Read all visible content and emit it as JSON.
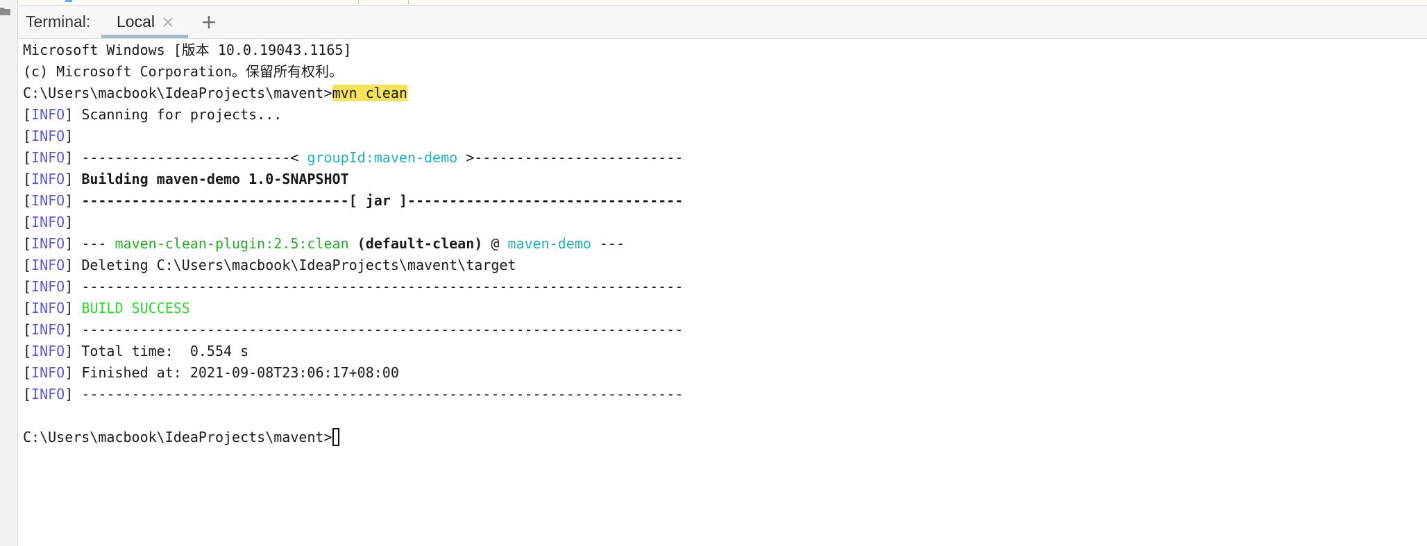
{
  "header": {
    "title": "Terminal:",
    "tabs": [
      {
        "label": "Local"
      }
    ]
  },
  "colors": {
    "info_level": "#5a5ad6",
    "cyan": "#1ab5b8",
    "green": "#22b022",
    "success": "#2bd92b",
    "command_highlight": "#f7e35a"
  },
  "icons": [
    "folder-icon",
    "close-icon",
    "plus-icon"
  ],
  "terminal": {
    "lines": {
      "l1": "Microsoft Windows [版本 10.0.19043.1165]",
      "l2": "(c) Microsoft Corporation。保留所有权利。",
      "l3": {
        "prompt": "C:\\Users\\macbook\\IdeaProjects\\mavent>",
        "command": "mvn clean"
      },
      "l4": {
        "open": "[",
        "level": "INFO",
        "close": "] ",
        "text": "Scanning for projects..."
      },
      "l5": {
        "open": "[",
        "level": "INFO",
        "close": "]"
      },
      "l6": {
        "open": "[",
        "level": "INFO",
        "close": "] ",
        "pre": "-------------------------< ",
        "id": "groupId:maven-demo",
        "post": " >-------------------------"
      },
      "l7": {
        "open": "[",
        "level": "INFO",
        "close": "] ",
        "text": "Building maven-demo 1.0-SNAPSHOT"
      },
      "l8": {
        "open": "[",
        "level": "INFO",
        "close": "] ",
        "text": "--------------------------------[ jar ]---------------------------------"
      },
      "l9": {
        "open": "[",
        "level": "INFO",
        "close": "]"
      },
      "l10": {
        "open": "[",
        "level": "INFO",
        "close": "] ",
        "dashes1": "--- ",
        "plugin": "maven-clean-plugin:2.5:clean",
        "exec": " (default-clean)",
        "at": " @ ",
        "project": "maven-demo",
        "dashes2": " ---"
      },
      "l11": {
        "open": "[",
        "level": "INFO",
        "close": "] ",
        "text": "Deleting C:\\Users\\macbook\\IdeaProjects\\mavent\\target"
      },
      "l12": {
        "open": "[",
        "level": "INFO",
        "close": "] ",
        "text": "------------------------------------------------------------------------"
      },
      "l13": {
        "open": "[",
        "level": "INFO",
        "close": "] ",
        "text": "BUILD SUCCESS"
      },
      "l14": {
        "open": "[",
        "level": "INFO",
        "close": "] ",
        "text": "------------------------------------------------------------------------"
      },
      "l15": {
        "open": "[",
        "level": "INFO",
        "close": "] ",
        "text": "Total time:  0.554 s"
      },
      "l16": {
        "open": "[",
        "level": "INFO",
        "close": "] ",
        "text": "Finished at: 2021-09-08T23:06:17+08:00"
      },
      "l17": {
        "open": "[",
        "level": "INFO",
        "close": "] ",
        "text": "------------------------------------------------------------------------"
      },
      "l19": {
        "prompt": "C:\\Users\\macbook\\IdeaProjects\\mavent>"
      }
    }
  }
}
